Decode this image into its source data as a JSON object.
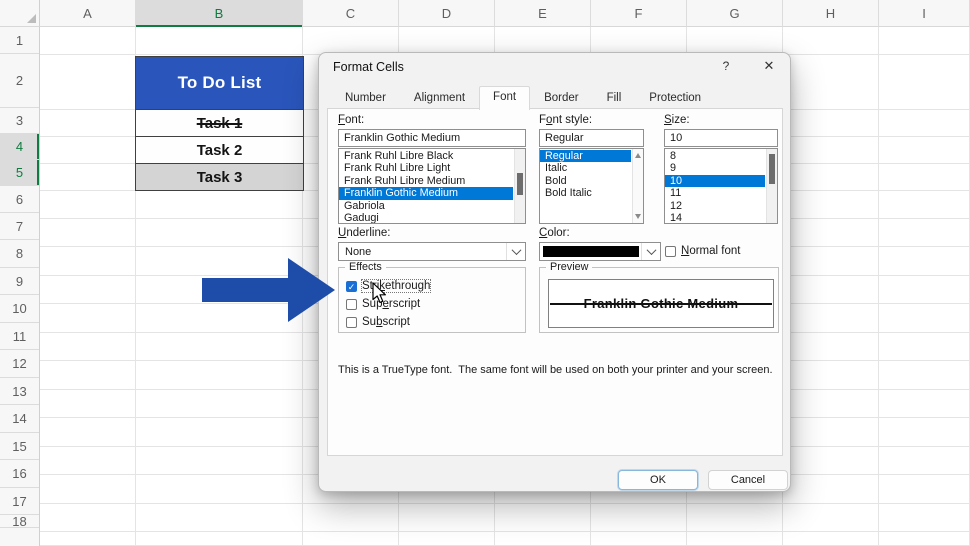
{
  "colors": {
    "excel_green": "#107c41",
    "todo_header_blue": "#2a55bb",
    "list_selection_blue": "#0078d7",
    "arrow_blue": "#1e4ca9",
    "font_color_swatch": "#000000",
    "selected_cell_fill": "#d4d4d4"
  },
  "icons": {
    "help": "?",
    "close": "✕",
    "check": "✓",
    "chevron_down": "chevron-down",
    "scroll_up": "triangle-up",
    "scroll_down": "triangle-down"
  },
  "spreadsheet": {
    "columns": [
      "A",
      "B",
      "C",
      "D",
      "E",
      "F",
      "G",
      "H",
      "I"
    ],
    "rows": [
      "1",
      "2",
      "3",
      "4",
      "5",
      "6",
      "7",
      "8",
      "9",
      "10",
      "11",
      "12",
      "13",
      "14",
      "15",
      "16",
      "17",
      "18"
    ],
    "selected_column": "B",
    "selected_rows": [
      "4",
      "5"
    ],
    "todo": {
      "header": "To Do List",
      "tasks": [
        {
          "label": "Task 1",
          "strikethrough": true,
          "selected": false
        },
        {
          "label": "Task 2",
          "strikethrough": false,
          "selected": false
        },
        {
          "label": "Task 3",
          "strikethrough": false,
          "selected": true
        }
      ]
    }
  },
  "dialog": {
    "title": "Format Cells",
    "tabs": [
      {
        "label": "Number",
        "active": false
      },
      {
        "label": "Alignment",
        "active": false
      },
      {
        "label": "Font",
        "active": true
      },
      {
        "label": "Border",
        "active": false
      },
      {
        "label": "Fill",
        "active": false
      },
      {
        "label": "Protection",
        "active": false
      }
    ],
    "font": {
      "label": {
        "text": "Font:",
        "accel": 0
      },
      "value": "Franklin Gothic Medium",
      "options": [
        "Frank Ruhl Libre Black",
        "Frank Ruhl Libre Light",
        "Frank Ruhl Libre Medium",
        "Franklin Gothic Medium",
        "Gabriola",
        "Gadugi"
      ],
      "selected": "Franklin Gothic Medium"
    },
    "font_style": {
      "label": {
        "text": "Font style:",
        "accel": 1
      },
      "value": "Regular",
      "options": [
        "Regular",
        "Italic",
        "Bold",
        "Bold Italic"
      ],
      "selected": "Regular"
    },
    "size": {
      "label": {
        "text": "Size:",
        "accel": 0
      },
      "value": "10",
      "options": [
        "8",
        "9",
        "10",
        "11",
        "12",
        "14"
      ],
      "selected": "10"
    },
    "underline": {
      "label": {
        "text": "Underline:",
        "accel": 0
      },
      "value": "None"
    },
    "color": {
      "label": {
        "text": "Color:",
        "accel": 0
      },
      "swatch": "#000000"
    },
    "normal_font": {
      "label": {
        "text": "Normal font",
        "accel": 0
      },
      "checked": false
    },
    "effects": {
      "legend": "Effects",
      "items": [
        {
          "label": {
            "text": "Strikethrough",
            "accel": 4
          },
          "checked": true,
          "focused": true
        },
        {
          "label": {
            "text": "Superscript",
            "accel": 3
          },
          "checked": false,
          "focused": false
        },
        {
          "label": {
            "text": "Subscript",
            "accel": 2
          },
          "checked": false,
          "focused": false
        }
      ]
    },
    "preview": {
      "legend": "Preview",
      "text": "Franklin Gothic Medium"
    },
    "description": "This is a TrueType font.  The same font will be used on both your printer and your screen.",
    "buttons": {
      "ok": "OK",
      "cancel": "Cancel"
    }
  }
}
